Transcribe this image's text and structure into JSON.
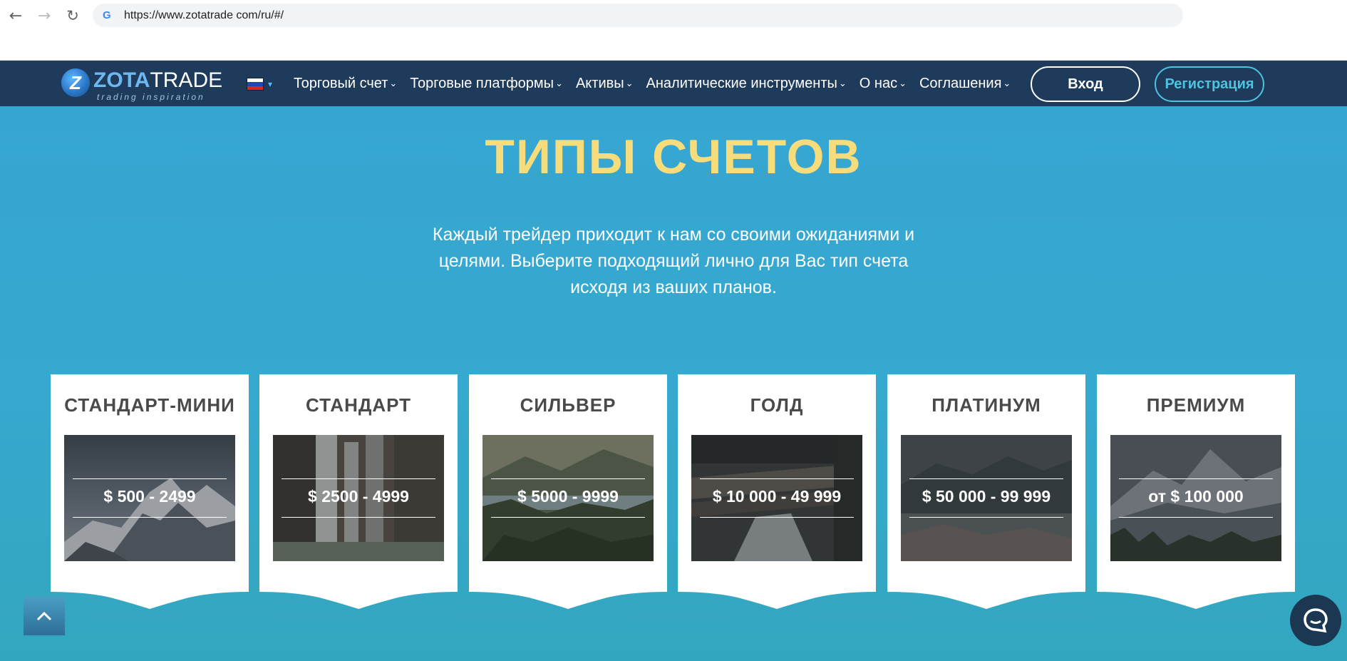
{
  "browser": {
    "url": "https://www.zotatrade com/ru/#/",
    "google_icon_letter": "G",
    "icons": [
      "back-arrow-icon",
      "forward-arrow-icon",
      "reload-icon",
      "google-icon"
    ]
  },
  "header": {
    "logo": {
      "brand_part1": "ZOTA",
      "brand_part2": "TRADE",
      "tagline": "trading inspiration",
      "mark_letter": "Z"
    },
    "language": {
      "flag": "ru-flag-icon",
      "caret": "▾"
    },
    "menu": [
      {
        "label": "Торговый счет",
        "chevron": "⌄"
      },
      {
        "label": "Торговые платформы",
        "chevron": "⌄"
      },
      {
        "label": "Активы",
        "chevron": "⌄"
      },
      {
        "label": "Аналитические инструменты",
        "chevron": "⌄"
      },
      {
        "label": "О нас",
        "chevron": "⌄"
      },
      {
        "label": "Соглашения",
        "chevron": "⌄"
      }
    ],
    "login_label": "Вход",
    "register_label": "Регистрация"
  },
  "main": {
    "title": "ТИПЫ СЧЕТОВ",
    "subtitle_lines": [
      "Каждый трейдер приходит к нам со своими ожиданиями и",
      "целями. Выберите подходящий лично для Вас тип счета",
      "исходя из ваших планов."
    ],
    "cards": [
      {
        "name": "СТАНДАРТ-МИНИ",
        "price": "$ 500 - 2499",
        "image": "mountain-peak"
      },
      {
        "name": "СТАНДАРТ",
        "price": "$ 2500 - 4999",
        "image": "waterfall"
      },
      {
        "name": "СИЛЬВЕР",
        "price": "$ 5000 - 9999",
        "image": "valley-lake"
      },
      {
        "name": "ГОЛД",
        "price": "$ 10 000 - 49 999",
        "image": "river-logs"
      },
      {
        "name": "ПЛАТИНУМ",
        "price": "$ 50 000 - 99 999",
        "image": "misty-lake"
      },
      {
        "name": "ПРЕМИУМ",
        "price": "от $ 100 000",
        "image": "mountain-forest"
      }
    ]
  },
  "widgets": {
    "scroll_top": "chevron-up-icon",
    "chat": "chat-bubble-icon"
  },
  "colors": {
    "header_bg": "#1f3b5c",
    "section_bg": "#36a5d2",
    "title": "#f6dc7a",
    "register_accent": "#4ec3e0",
    "card_title": "#4a4a4a"
  }
}
